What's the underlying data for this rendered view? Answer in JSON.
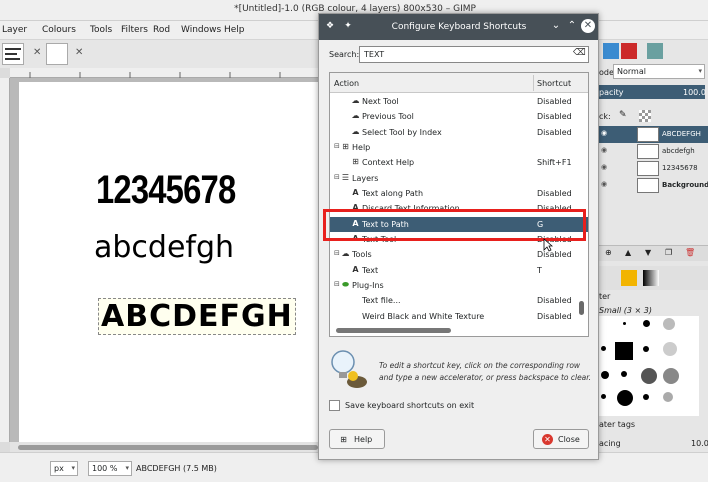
{
  "window": {
    "title": "*[Untitled]-1.0 (RGB colour, 4 layers) 800x530 – GIMP"
  },
  "menubar": {
    "items": [
      "Layer",
      "Colours",
      "Tools",
      "Filters",
      "Rod",
      "Windows",
      "Help"
    ]
  },
  "canvas": {
    "text_numbers": "12345678",
    "text_lower": "abcdefgh",
    "text_upper": "ABCDEFGH"
  },
  "statusbar": {
    "unit": "px",
    "zoom": "100 %",
    "layer_info": "ABCDEFGH (7.5 MB)"
  },
  "dock": {
    "mode_label": "ode:",
    "mode_value": "Normal",
    "opacity_label": "pacity",
    "opacity_value": "100.0",
    "lock_label": "ck:",
    "layers": [
      {
        "name": "ABCDEFGH",
        "selected": true
      },
      {
        "name": "abcdefgh",
        "selected": false
      },
      {
        "name": "12345678",
        "selected": false
      },
      {
        "name": "Background",
        "selected": false
      }
    ],
    "filter_label": "ter",
    "brush_name": "Small (3 × 3)",
    "tags_label": "ater tags",
    "spacing_label": "acing",
    "spacing_value": "10.0"
  },
  "dialog": {
    "title": "Configure Keyboard Shortcuts",
    "search_label": "Search:",
    "search_value": "TEXT",
    "col_action": "Action",
    "col_shortcut": "Shortcut",
    "rows": [
      {
        "label": "Next Tool",
        "shortcut": "Disabled",
        "indent": 2,
        "icon": "tool",
        "group": false
      },
      {
        "label": "Previous Tool",
        "shortcut": "Disabled",
        "indent": 2,
        "icon": "tool",
        "group": false
      },
      {
        "label": "Select Tool by Index",
        "shortcut": "Disabled",
        "indent": 2,
        "icon": "tool",
        "group": false
      },
      {
        "label": "Help",
        "shortcut": "",
        "indent": 1,
        "icon": "help",
        "group": true
      },
      {
        "label": "Context Help",
        "shortcut": "Shift+F1",
        "indent": 2,
        "icon": "help",
        "group": false
      },
      {
        "label": "Layers",
        "shortcut": "",
        "indent": 1,
        "icon": "layers",
        "group": true
      },
      {
        "label": "Text along Path",
        "shortcut": "Disabled",
        "indent": 2,
        "icon": "text",
        "group": false
      },
      {
        "label": "Discard Text Information",
        "shortcut": "Disabled",
        "indent": 2,
        "icon": "text",
        "group": false
      },
      {
        "label": "Text to Path",
        "shortcut": "G",
        "indent": 2,
        "icon": "text",
        "group": false,
        "selected": true
      },
      {
        "label": "Text Tool",
        "shortcut": "Disabled",
        "indent": 2,
        "icon": "text",
        "group": false
      },
      {
        "label": "Tools",
        "shortcut": "Disabled",
        "indent": 1,
        "icon": "tool",
        "group": true
      },
      {
        "label": "Text",
        "shortcut": "T",
        "indent": 2,
        "icon": "text",
        "group": false
      },
      {
        "label": "Plug-Ins",
        "shortcut": "",
        "indent": 1,
        "icon": "plugin",
        "group": true
      },
      {
        "label": "Text file...",
        "shortcut": "Disabled",
        "indent": 2,
        "icon": "",
        "group": false
      },
      {
        "label": "Weird Black and White Texture",
        "shortcut": "Disabled",
        "indent": 2,
        "icon": "",
        "group": false
      }
    ],
    "hint": "To edit a shortcut key, click on the corresponding row and type a new accelerator, or press backspace to clear.",
    "save_label": "Save keyboard shortcuts on exit",
    "help_button": "Help",
    "close_button": "Close"
  },
  "colors": {
    "selection": "#3d5d75",
    "highlight_box": "#e8201d",
    "dialog_titlebar": "#475057"
  }
}
